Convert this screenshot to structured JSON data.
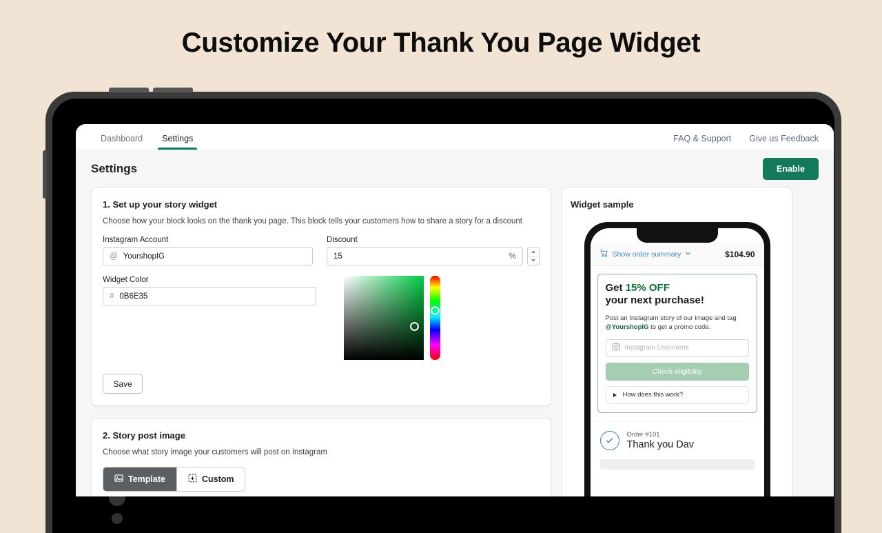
{
  "hero": {
    "title": "Customize Your Thank You Page Widget"
  },
  "theme": {
    "page_bg": "#f2e4d5",
    "brand_green": "#0B6E35",
    "enable_green": "#12795a",
    "tab_accent": "#008060",
    "link_blue": "#5c6b82"
  },
  "app": {
    "nav": {
      "tabs": [
        {
          "label": "Dashboard",
          "active": false
        },
        {
          "label": "Settings",
          "active": true
        }
      ],
      "links": [
        {
          "label": "FAQ & Support"
        },
        {
          "label": "Give us Feedback"
        }
      ]
    },
    "header": {
      "title": "Settings",
      "enable_button": "Enable"
    },
    "section1": {
      "title": "1. Set up your story widget",
      "description": "Choose how your block looks on the thank you page. This block tells your customers how to share a story for a discount",
      "instagram_label": "Instagram Account",
      "instagram_prefix": "@",
      "instagram_value": "YourshopIG",
      "discount_label": "Discount",
      "discount_value": "15",
      "discount_suffix": "%",
      "color_label": "Widget Color",
      "color_prefix": "#",
      "color_value": "0B6E35",
      "save_button": "Save"
    },
    "section2": {
      "title": "2. Story post image",
      "description": "Choose what story image your customers will post on Instagram",
      "options": [
        {
          "label": "Template",
          "icon": "image-icon",
          "active": true
        },
        {
          "label": "Custom",
          "icon": "add-frame-icon",
          "active": false
        }
      ]
    },
    "preview": {
      "title": "Widget sample",
      "order_summary_label": "Show order summary",
      "order_total": "$104.90",
      "promo_prefix": "Get ",
      "promo_accent": "15% OFF",
      "promo_line2": "your next purchase!",
      "promo_body_1": "Post an Instagram story of our image and tag ",
      "promo_tag": "@YourshopIG",
      "promo_body_2": " to get a promo code.",
      "username_placeholder": "Instagram Username",
      "check_button": "Check eligibility",
      "how_label": "How does this work?",
      "order_number": "Order #101",
      "thank_you": "Thank you Dav"
    }
  }
}
